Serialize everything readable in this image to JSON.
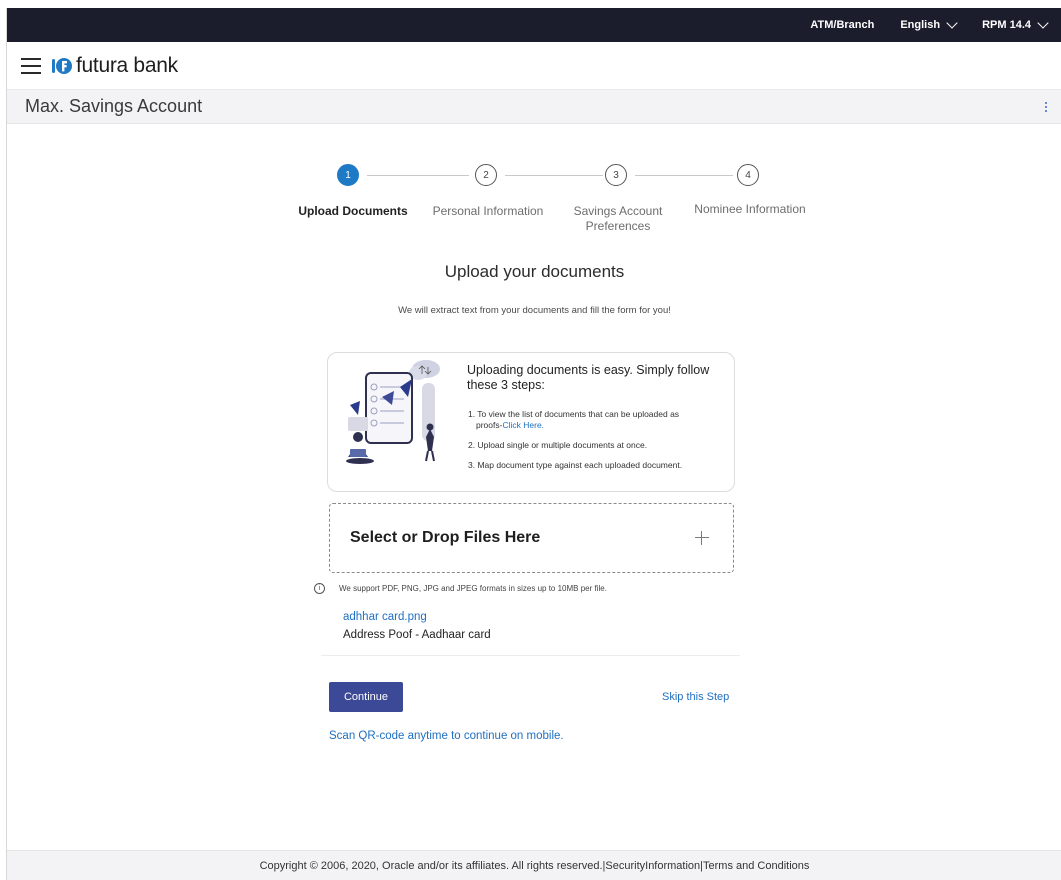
{
  "topbar": {
    "items": [
      {
        "label": "ATM/Branch",
        "dropdown": false
      },
      {
        "label": "English",
        "dropdown": true
      },
      {
        "label": "RPM 14.4",
        "dropdown": true
      }
    ]
  },
  "brand": {
    "name": "futura bank",
    "logo_icon": "futura-logo-icon",
    "menu_icon": "hamburger-icon"
  },
  "page": {
    "title": "Max. Savings Account",
    "options_icon": "kebab-menu-icon"
  },
  "stepper": {
    "steps": [
      {
        "number": "1",
        "label": "Upload Documents",
        "active": true
      },
      {
        "number": "2",
        "label": "Personal Information",
        "active": false
      },
      {
        "number": "3",
        "label_line1": "Savings Account",
        "label_line2": "Preferences",
        "active": false
      },
      {
        "number": "4",
        "label": "Nominee Information",
        "active": false
      }
    ]
  },
  "main": {
    "heading": "Upload your documents",
    "subheading": "We will extract text from your documents and fill the form for you!"
  },
  "info_card": {
    "title": "Uploading documents is easy. Simply follow these 3 steps:",
    "step1_line1": "1. To view the list of documents that can be uploaded as",
    "step1_prefix": "proofs-",
    "step1_link": "Click Here.",
    "step2": "2. Upload single or multiple documents at once.",
    "step3": "3. Map document type against each uploaded document."
  },
  "dropzone": {
    "label": "Select or Drop Files Here",
    "add_icon": "plus-icon"
  },
  "support_note": "We support PDF, PNG, JPG and JPEG formats in sizes up to 10MB per file.",
  "uploaded_file": {
    "name": "adhhar card.png",
    "type": "Address Poof - Aadhaar card"
  },
  "actions": {
    "continue": "Continue",
    "skip": "Skip this Step",
    "qr": "Scan QR-code anytime to continue on mobile."
  },
  "footer": {
    "text": "Copyright © 2006, 2020, Oracle and/or its affiliates. All rights reserved.|SecurityInformation|Terms and Conditions"
  },
  "colors": {
    "topbar_bg": "#1b1c2c",
    "accent_blue": "#1f7ac6",
    "button_bg": "#3b4996",
    "link": "#1f6fc1"
  }
}
